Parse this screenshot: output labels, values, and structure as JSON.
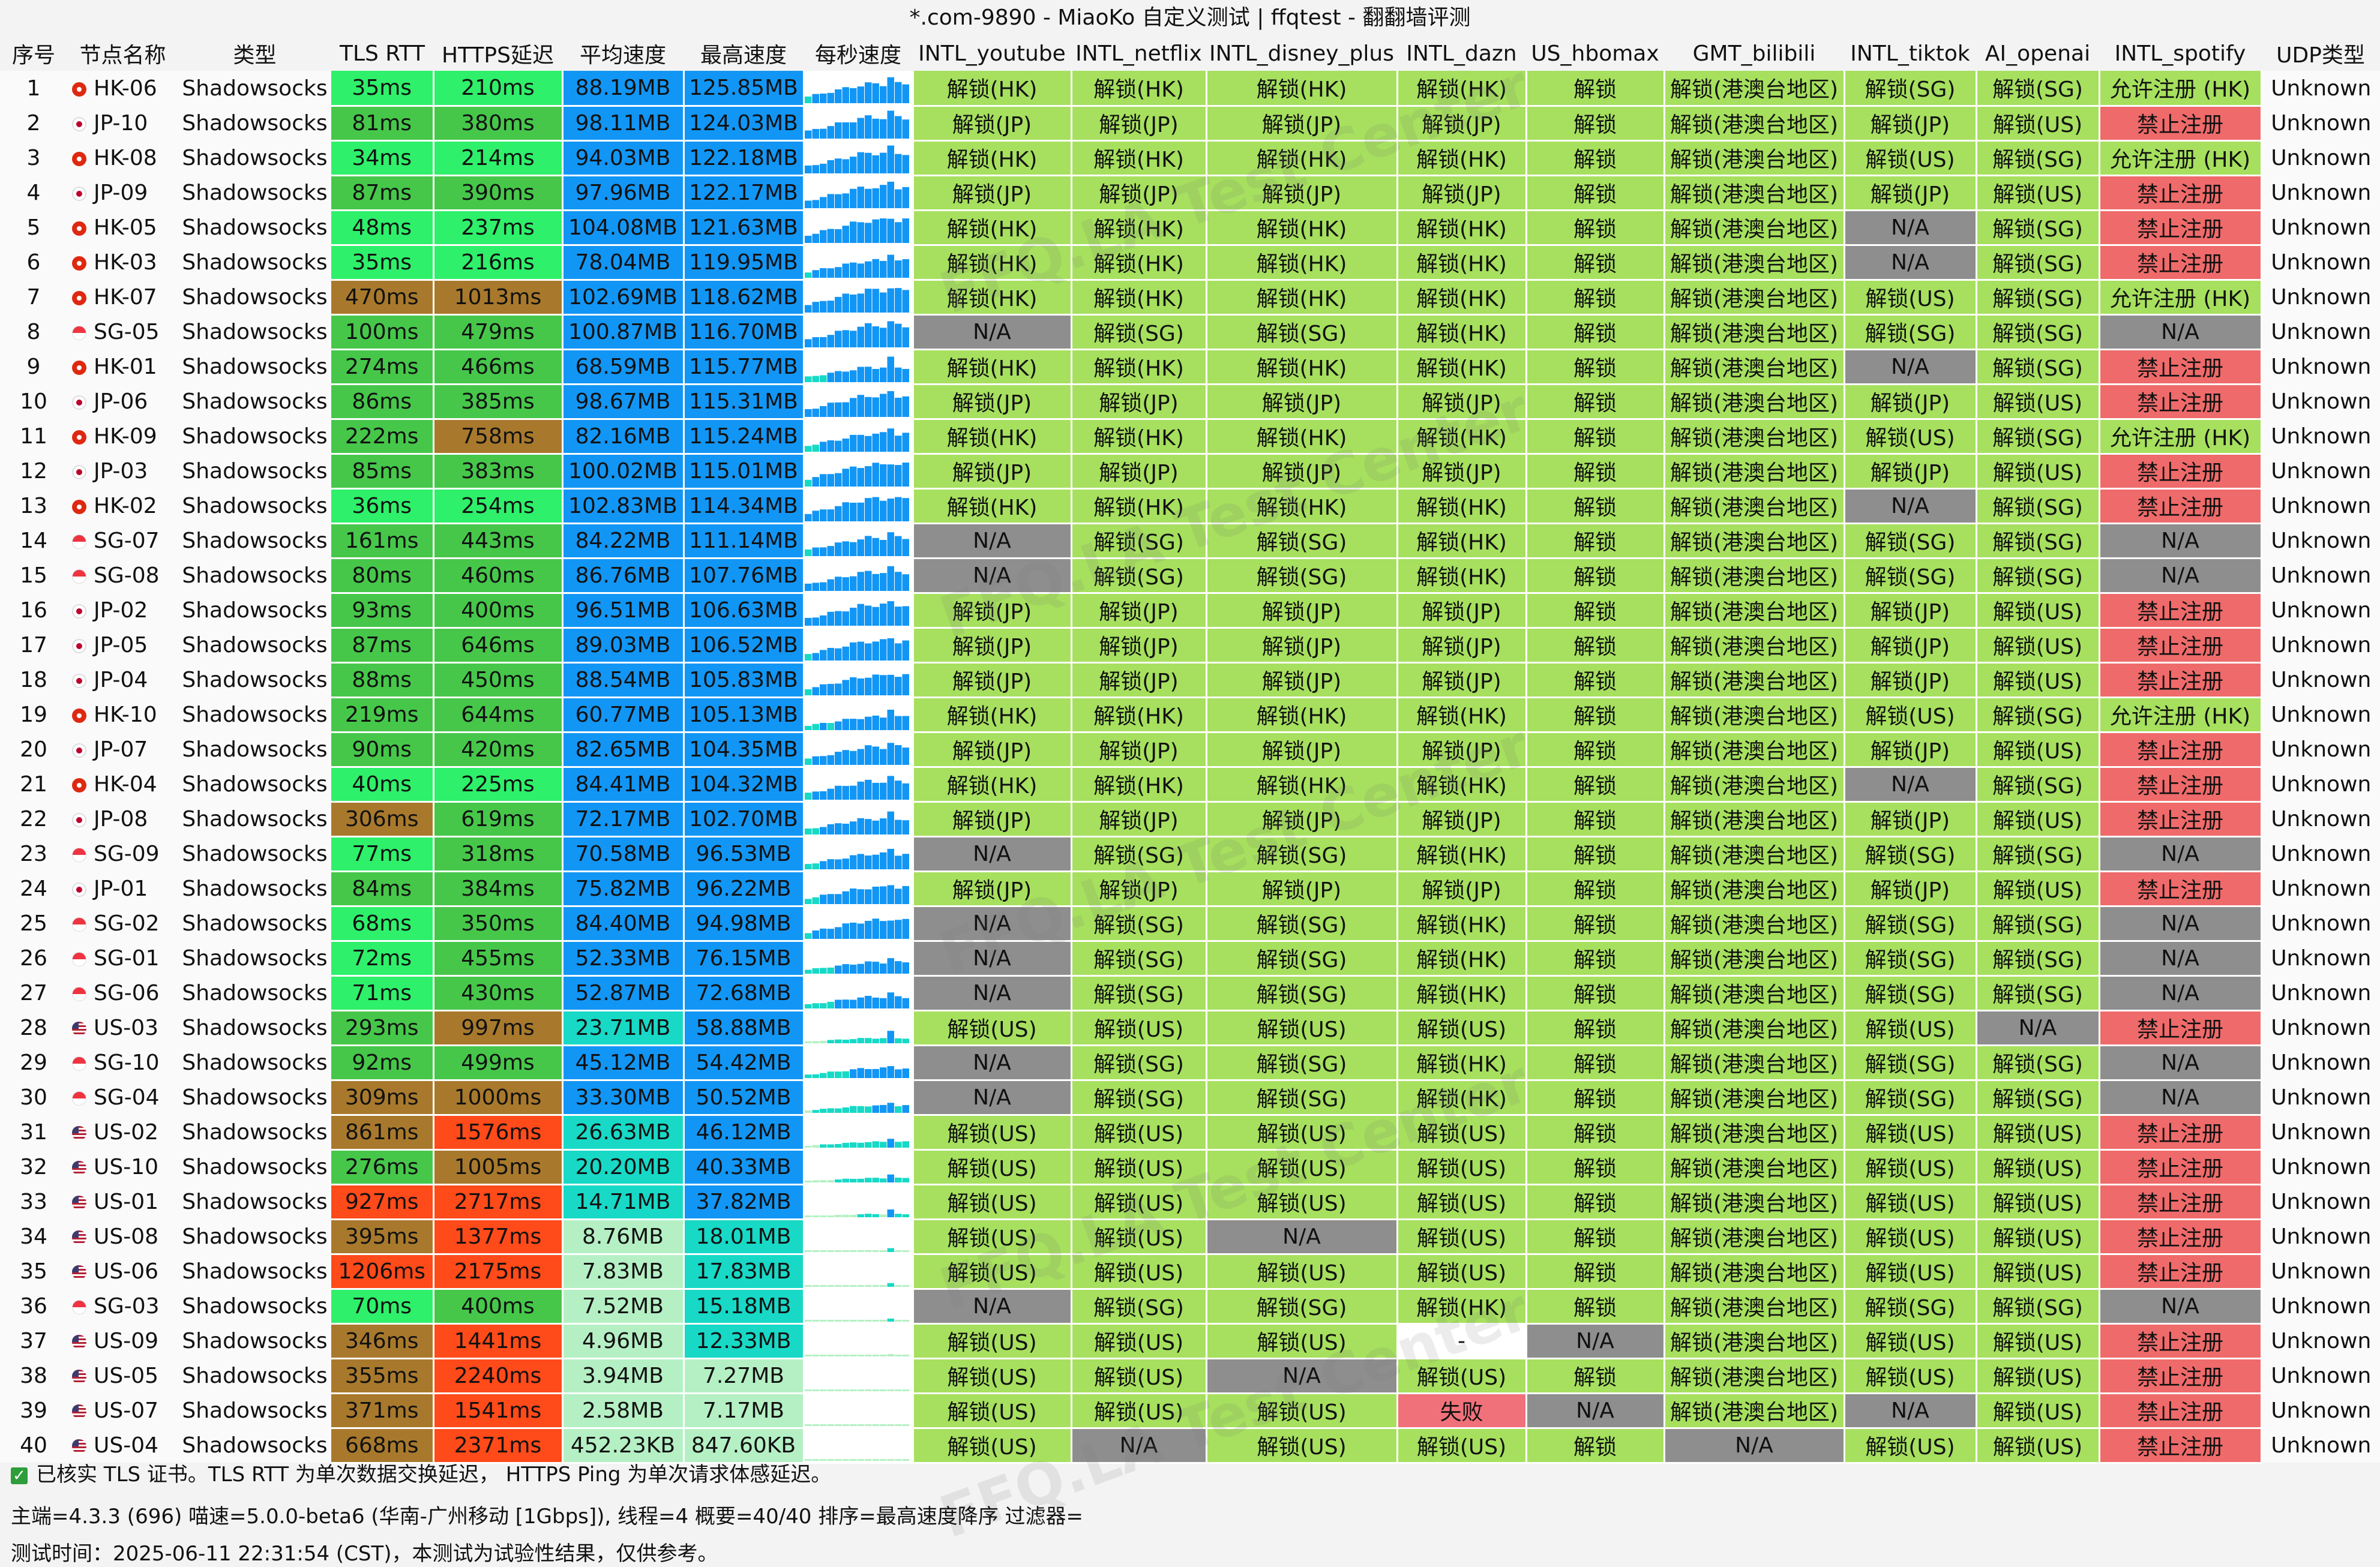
{
  "title": "*.com-9890 - MiaoKo 自定义测试 | ffqtest - 翻翻墙评测",
  "headers": [
    "序号",
    "节点名称",
    "类型",
    "TLS RTT",
    "HTTPS延迟",
    "平均速度",
    "最高速度",
    "每秒速度",
    "INTL_youtube",
    "INTL_netflix",
    "INTL_disney_plus",
    "INTL_dazn",
    "US_hbomax",
    "GMT_bilibili",
    "INTL_tiktok",
    "AI_openai",
    "INTL_spotify",
    "UDP类型"
  ],
  "rows": [
    {
      "no": "1",
      "name": "HK-06",
      "flag": "hk",
      "type": "Shadowsocks",
      "tls": "35ms",
      "https": "210ms",
      "avg": "88.19MB",
      "max": "125.85MB",
      "youtube": "解锁(HK)",
      "netflix": "解锁(HK)",
      "disney": "解锁(HK)",
      "dazn": "解锁(HK)",
      "hbomax": "解锁",
      "bilibili": "解锁(港澳台地区)",
      "tiktok": "解锁(SG)",
      "openai": "解锁(SG)",
      "spotify": "允许注册 (HK)",
      "udp": "Unknown"
    },
    {
      "no": "2",
      "name": "JP-10",
      "flag": "jp",
      "type": "Shadowsocks",
      "tls": "81ms",
      "https": "380ms",
      "avg": "98.11MB",
      "max": "124.03MB",
      "youtube": "解锁(JP)",
      "netflix": "解锁(JP)",
      "disney": "解锁(JP)",
      "dazn": "解锁(JP)",
      "hbomax": "解锁",
      "bilibili": "解锁(港澳台地区)",
      "tiktok": "解锁(JP)",
      "openai": "解锁(US)",
      "spotify": "禁止注册",
      "udp": "Unknown"
    },
    {
      "no": "3",
      "name": "HK-08",
      "flag": "hk",
      "type": "Shadowsocks",
      "tls": "34ms",
      "https": "214ms",
      "avg": "94.03MB",
      "max": "122.18MB",
      "youtube": "解锁(HK)",
      "netflix": "解锁(HK)",
      "disney": "解锁(HK)",
      "dazn": "解锁(HK)",
      "hbomax": "解锁",
      "bilibili": "解锁(港澳台地区)",
      "tiktok": "解锁(US)",
      "openai": "解锁(SG)",
      "spotify": "允许注册 (HK)",
      "udp": "Unknown"
    },
    {
      "no": "4",
      "name": "JP-09",
      "flag": "jp",
      "type": "Shadowsocks",
      "tls": "87ms",
      "https": "390ms",
      "avg": "97.96MB",
      "max": "122.17MB",
      "youtube": "解锁(JP)",
      "netflix": "解锁(JP)",
      "disney": "解锁(JP)",
      "dazn": "解锁(JP)",
      "hbomax": "解锁",
      "bilibili": "解锁(港澳台地区)",
      "tiktok": "解锁(JP)",
      "openai": "解锁(US)",
      "spotify": "禁止注册",
      "udp": "Unknown"
    },
    {
      "no": "5",
      "name": "HK-05",
      "flag": "hk",
      "type": "Shadowsocks",
      "tls": "48ms",
      "https": "237ms",
      "avg": "104.08MB",
      "max": "121.63MB",
      "youtube": "解锁(HK)",
      "netflix": "解锁(HK)",
      "disney": "解锁(HK)",
      "dazn": "解锁(HK)",
      "hbomax": "解锁",
      "bilibili": "解锁(港澳台地区)",
      "tiktok": "N/A",
      "openai": "解锁(SG)",
      "spotify": "禁止注册",
      "udp": "Unknown"
    },
    {
      "no": "6",
      "name": "HK-03",
      "flag": "hk",
      "type": "Shadowsocks",
      "tls": "35ms",
      "https": "216ms",
      "avg": "78.04MB",
      "max": "119.95MB",
      "youtube": "解锁(HK)",
      "netflix": "解锁(HK)",
      "disney": "解锁(HK)",
      "dazn": "解锁(HK)",
      "hbomax": "解锁",
      "bilibili": "解锁(港澳台地区)",
      "tiktok": "N/A",
      "openai": "解锁(SG)",
      "spotify": "禁止注册",
      "udp": "Unknown"
    },
    {
      "no": "7",
      "name": "HK-07",
      "flag": "hk",
      "type": "Shadowsocks",
      "tls": "470ms",
      "https": "1013ms",
      "avg": "102.69MB",
      "max": "118.62MB",
      "youtube": "解锁(HK)",
      "netflix": "解锁(HK)",
      "disney": "解锁(HK)",
      "dazn": "解锁(HK)",
      "hbomax": "解锁",
      "bilibili": "解锁(港澳台地区)",
      "tiktok": "解锁(US)",
      "openai": "解锁(SG)",
      "spotify": "允许注册 (HK)",
      "udp": "Unknown"
    },
    {
      "no": "8",
      "name": "SG-05",
      "flag": "sg",
      "type": "Shadowsocks",
      "tls": "100ms",
      "https": "479ms",
      "avg": "100.87MB",
      "max": "116.70MB",
      "youtube": "N/A",
      "netflix": "解锁(SG)",
      "disney": "解锁(SG)",
      "dazn": "解锁(HK)",
      "hbomax": "解锁",
      "bilibili": "解锁(港澳台地区)",
      "tiktok": "解锁(SG)",
      "openai": "解锁(SG)",
      "spotify": "N/A",
      "udp": "Unknown"
    },
    {
      "no": "9",
      "name": "HK-01",
      "flag": "hk",
      "type": "Shadowsocks",
      "tls": "274ms",
      "https": "466ms",
      "avg": "68.59MB",
      "max": "115.77MB",
      "youtube": "解锁(HK)",
      "netflix": "解锁(HK)",
      "disney": "解锁(HK)",
      "dazn": "解锁(HK)",
      "hbomax": "解锁",
      "bilibili": "解锁(港澳台地区)",
      "tiktok": "N/A",
      "openai": "解锁(SG)",
      "spotify": "禁止注册",
      "udp": "Unknown"
    },
    {
      "no": "10",
      "name": "JP-06",
      "flag": "jp",
      "type": "Shadowsocks",
      "tls": "86ms",
      "https": "385ms",
      "avg": "98.67MB",
      "max": "115.31MB",
      "youtube": "解锁(JP)",
      "netflix": "解锁(JP)",
      "disney": "解锁(JP)",
      "dazn": "解锁(JP)",
      "hbomax": "解锁",
      "bilibili": "解锁(港澳台地区)",
      "tiktok": "解锁(JP)",
      "openai": "解锁(US)",
      "spotify": "禁止注册",
      "udp": "Unknown"
    },
    {
      "no": "11",
      "name": "HK-09",
      "flag": "hk",
      "type": "Shadowsocks",
      "tls": "222ms",
      "https": "758ms",
      "avg": "82.16MB",
      "max": "115.24MB",
      "youtube": "解锁(HK)",
      "netflix": "解锁(HK)",
      "disney": "解锁(HK)",
      "dazn": "解锁(HK)",
      "hbomax": "解锁",
      "bilibili": "解锁(港澳台地区)",
      "tiktok": "解锁(US)",
      "openai": "解锁(SG)",
      "spotify": "允许注册 (HK)",
      "udp": "Unknown"
    },
    {
      "no": "12",
      "name": "JP-03",
      "flag": "jp",
      "type": "Shadowsocks",
      "tls": "85ms",
      "https": "383ms",
      "avg": "100.02MB",
      "max": "115.01MB",
      "youtube": "解锁(JP)",
      "netflix": "解锁(JP)",
      "disney": "解锁(JP)",
      "dazn": "解锁(JP)",
      "hbomax": "解锁",
      "bilibili": "解锁(港澳台地区)",
      "tiktok": "解锁(JP)",
      "openai": "解锁(US)",
      "spotify": "禁止注册",
      "udp": "Unknown"
    },
    {
      "no": "13",
      "name": "HK-02",
      "flag": "hk",
      "type": "Shadowsocks",
      "tls": "36ms",
      "https": "254ms",
      "avg": "102.83MB",
      "max": "114.34MB",
      "youtube": "解锁(HK)",
      "netflix": "解锁(HK)",
      "disney": "解锁(HK)",
      "dazn": "解锁(HK)",
      "hbomax": "解锁",
      "bilibili": "解锁(港澳台地区)",
      "tiktok": "N/A",
      "openai": "解锁(SG)",
      "spotify": "禁止注册",
      "udp": "Unknown"
    },
    {
      "no": "14",
      "name": "SG-07",
      "flag": "sg",
      "type": "Shadowsocks",
      "tls": "161ms",
      "https": "443ms",
      "avg": "84.22MB",
      "max": "111.14MB",
      "youtube": "N/A",
      "netflix": "解锁(SG)",
      "disney": "解锁(SG)",
      "dazn": "解锁(HK)",
      "hbomax": "解锁",
      "bilibili": "解锁(港澳台地区)",
      "tiktok": "解锁(SG)",
      "openai": "解锁(SG)",
      "spotify": "N/A",
      "udp": "Unknown"
    },
    {
      "no": "15",
      "name": "SG-08",
      "flag": "sg",
      "type": "Shadowsocks",
      "tls": "80ms",
      "https": "460ms",
      "avg": "86.76MB",
      "max": "107.76MB",
      "youtube": "N/A",
      "netflix": "解锁(SG)",
      "disney": "解锁(SG)",
      "dazn": "解锁(HK)",
      "hbomax": "解锁",
      "bilibili": "解锁(港澳台地区)",
      "tiktok": "解锁(SG)",
      "openai": "解锁(SG)",
      "spotify": "N/A",
      "udp": "Unknown"
    },
    {
      "no": "16",
      "name": "JP-02",
      "flag": "jp",
      "type": "Shadowsocks",
      "tls": "93ms",
      "https": "400ms",
      "avg": "96.51MB",
      "max": "106.63MB",
      "youtube": "解锁(JP)",
      "netflix": "解锁(JP)",
      "disney": "解锁(JP)",
      "dazn": "解锁(JP)",
      "hbomax": "解锁",
      "bilibili": "解锁(港澳台地区)",
      "tiktok": "解锁(JP)",
      "openai": "解锁(US)",
      "spotify": "禁止注册",
      "udp": "Unknown"
    },
    {
      "no": "17",
      "name": "JP-05",
      "flag": "jp",
      "type": "Shadowsocks",
      "tls": "87ms",
      "https": "646ms",
      "avg": "89.03MB",
      "max": "106.52MB",
      "youtube": "解锁(JP)",
      "netflix": "解锁(JP)",
      "disney": "解锁(JP)",
      "dazn": "解锁(JP)",
      "hbomax": "解锁",
      "bilibili": "解锁(港澳台地区)",
      "tiktok": "解锁(JP)",
      "openai": "解锁(US)",
      "spotify": "禁止注册",
      "udp": "Unknown"
    },
    {
      "no": "18",
      "name": "JP-04",
      "flag": "jp",
      "type": "Shadowsocks",
      "tls": "88ms",
      "https": "450ms",
      "avg": "88.54MB",
      "max": "105.83MB",
      "youtube": "解锁(JP)",
      "netflix": "解锁(JP)",
      "disney": "解锁(JP)",
      "dazn": "解锁(JP)",
      "hbomax": "解锁",
      "bilibili": "解锁(港澳台地区)",
      "tiktok": "解锁(JP)",
      "openai": "解锁(US)",
      "spotify": "禁止注册",
      "udp": "Unknown"
    },
    {
      "no": "19",
      "name": "HK-10",
      "flag": "hk",
      "type": "Shadowsocks",
      "tls": "219ms",
      "https": "644ms",
      "avg": "60.77MB",
      "max": "105.13MB",
      "youtube": "解锁(HK)",
      "netflix": "解锁(HK)",
      "disney": "解锁(HK)",
      "dazn": "解锁(HK)",
      "hbomax": "解锁",
      "bilibili": "解锁(港澳台地区)",
      "tiktok": "解锁(US)",
      "openai": "解锁(SG)",
      "spotify": "允许注册 (HK)",
      "udp": "Unknown"
    },
    {
      "no": "20",
      "name": "JP-07",
      "flag": "jp",
      "type": "Shadowsocks",
      "tls": "90ms",
      "https": "420ms",
      "avg": "82.65MB",
      "max": "104.35MB",
      "youtube": "解锁(JP)",
      "netflix": "解锁(JP)",
      "disney": "解锁(JP)",
      "dazn": "解锁(JP)",
      "hbomax": "解锁",
      "bilibili": "解锁(港澳台地区)",
      "tiktok": "解锁(JP)",
      "openai": "解锁(US)",
      "spotify": "禁止注册",
      "udp": "Unknown"
    },
    {
      "no": "21",
      "name": "HK-04",
      "flag": "hk",
      "type": "Shadowsocks",
      "tls": "40ms",
      "https": "225ms",
      "avg": "84.41MB",
      "max": "104.32MB",
      "youtube": "解锁(HK)",
      "netflix": "解锁(HK)",
      "disney": "解锁(HK)",
      "dazn": "解锁(HK)",
      "hbomax": "解锁",
      "bilibili": "解锁(港澳台地区)",
      "tiktok": "N/A",
      "openai": "解锁(SG)",
      "spotify": "禁止注册",
      "udp": "Unknown"
    },
    {
      "no": "22",
      "name": "JP-08",
      "flag": "jp",
      "type": "Shadowsocks",
      "tls": "306ms",
      "https": "619ms",
      "avg": "72.17MB",
      "max": "102.70MB",
      "youtube": "解锁(JP)",
      "netflix": "解锁(JP)",
      "disney": "解锁(JP)",
      "dazn": "解锁(JP)",
      "hbomax": "解锁",
      "bilibili": "解锁(港澳台地区)",
      "tiktok": "解锁(JP)",
      "openai": "解锁(US)",
      "spotify": "禁止注册",
      "udp": "Unknown"
    },
    {
      "no": "23",
      "name": "SG-09",
      "flag": "sg",
      "type": "Shadowsocks",
      "tls": "77ms",
      "https": "318ms",
      "avg": "70.58MB",
      "max": "96.53MB",
      "youtube": "N/A",
      "netflix": "解锁(SG)",
      "disney": "解锁(SG)",
      "dazn": "解锁(HK)",
      "hbomax": "解锁",
      "bilibili": "解锁(港澳台地区)",
      "tiktok": "解锁(SG)",
      "openai": "解锁(SG)",
      "spotify": "N/A",
      "udp": "Unknown"
    },
    {
      "no": "24",
      "name": "JP-01",
      "flag": "jp",
      "type": "Shadowsocks",
      "tls": "84ms",
      "https": "384ms",
      "avg": "75.82MB",
      "max": "96.22MB",
      "youtube": "解锁(JP)",
      "netflix": "解锁(JP)",
      "disney": "解锁(JP)",
      "dazn": "解锁(JP)",
      "hbomax": "解锁",
      "bilibili": "解锁(港澳台地区)",
      "tiktok": "解锁(JP)",
      "openai": "解锁(US)",
      "spotify": "禁止注册",
      "udp": "Unknown"
    },
    {
      "no": "25",
      "name": "SG-02",
      "flag": "sg",
      "type": "Shadowsocks",
      "tls": "68ms",
      "https": "350ms",
      "avg": "84.40MB",
      "max": "94.98MB",
      "youtube": "N/A",
      "netflix": "解锁(SG)",
      "disney": "解锁(SG)",
      "dazn": "解锁(HK)",
      "hbomax": "解锁",
      "bilibili": "解锁(港澳台地区)",
      "tiktok": "解锁(SG)",
      "openai": "解锁(SG)",
      "spotify": "N/A",
      "udp": "Unknown"
    },
    {
      "no": "26",
      "name": "SG-01",
      "flag": "sg",
      "type": "Shadowsocks",
      "tls": "72ms",
      "https": "455ms",
      "avg": "52.33MB",
      "max": "76.15MB",
      "youtube": "N/A",
      "netflix": "解锁(SG)",
      "disney": "解锁(SG)",
      "dazn": "解锁(HK)",
      "hbomax": "解锁",
      "bilibili": "解锁(港澳台地区)",
      "tiktok": "解锁(SG)",
      "openai": "解锁(SG)",
      "spotify": "N/A",
      "udp": "Unknown"
    },
    {
      "no": "27",
      "name": "SG-06",
      "flag": "sg",
      "type": "Shadowsocks",
      "tls": "71ms",
      "https": "430ms",
      "avg": "52.87MB",
      "max": "72.68MB",
      "youtube": "N/A",
      "netflix": "解锁(SG)",
      "disney": "解锁(SG)",
      "dazn": "解锁(HK)",
      "hbomax": "解锁",
      "bilibili": "解锁(港澳台地区)",
      "tiktok": "解锁(SG)",
      "openai": "解锁(SG)",
      "spotify": "N/A",
      "udp": "Unknown"
    },
    {
      "no": "28",
      "name": "US-03",
      "flag": "us",
      "type": "Shadowsocks",
      "tls": "293ms",
      "https": "997ms",
      "avg": "23.71MB",
      "max": "58.88MB",
      "youtube": "解锁(US)",
      "netflix": "解锁(US)",
      "disney": "解锁(US)",
      "dazn": "解锁(US)",
      "hbomax": "解锁",
      "bilibili": "解锁(港澳台地区)",
      "tiktok": "解锁(US)",
      "openai": "N/A",
      "spotify": "禁止注册",
      "udp": "Unknown"
    },
    {
      "no": "29",
      "name": "SG-10",
      "flag": "sg",
      "type": "Shadowsocks",
      "tls": "92ms",
      "https": "499ms",
      "avg": "45.12MB",
      "max": "54.42MB",
      "youtube": "N/A",
      "netflix": "解锁(SG)",
      "disney": "解锁(SG)",
      "dazn": "解锁(HK)",
      "hbomax": "解锁",
      "bilibili": "解锁(港澳台地区)",
      "tiktok": "解锁(SG)",
      "openai": "解锁(SG)",
      "spotify": "N/A",
      "udp": "Unknown"
    },
    {
      "no": "30",
      "name": "SG-04",
      "flag": "sg",
      "type": "Shadowsocks",
      "tls": "309ms",
      "https": "1000ms",
      "avg": "33.30MB",
      "max": "50.52MB",
      "youtube": "N/A",
      "netflix": "解锁(SG)",
      "disney": "解锁(SG)",
      "dazn": "解锁(HK)",
      "hbomax": "解锁",
      "bilibili": "解锁(港澳台地区)",
      "tiktok": "解锁(SG)",
      "openai": "解锁(SG)",
      "spotify": "N/A",
      "udp": "Unknown"
    },
    {
      "no": "31",
      "name": "US-02",
      "flag": "us",
      "type": "Shadowsocks",
      "tls": "861ms",
      "https": "1576ms",
      "avg": "26.63MB",
      "max": "46.12MB",
      "youtube": "解锁(US)",
      "netflix": "解锁(US)",
      "disney": "解锁(US)",
      "dazn": "解锁(US)",
      "hbomax": "解锁",
      "bilibili": "解锁(港澳台地区)",
      "tiktok": "解锁(US)",
      "openai": "解锁(US)",
      "spotify": "禁止注册",
      "udp": "Unknown"
    },
    {
      "no": "32",
      "name": "US-10",
      "flag": "us",
      "type": "Shadowsocks",
      "tls": "276ms",
      "https": "1005ms",
      "avg": "20.20MB",
      "max": "40.33MB",
      "youtube": "解锁(US)",
      "netflix": "解锁(US)",
      "disney": "解锁(US)",
      "dazn": "解锁(US)",
      "hbomax": "解锁",
      "bilibili": "解锁(港澳台地区)",
      "tiktok": "解锁(US)",
      "openai": "解锁(US)",
      "spotify": "禁止注册",
      "udp": "Unknown"
    },
    {
      "no": "33",
      "name": "US-01",
      "flag": "us",
      "type": "Shadowsocks",
      "tls": "927ms",
      "https": "2717ms",
      "avg": "14.71MB",
      "max": "37.82MB",
      "youtube": "解锁(US)",
      "netflix": "解锁(US)",
      "disney": "解锁(US)",
      "dazn": "解锁(US)",
      "hbomax": "解锁",
      "bilibili": "解锁(港澳台地区)",
      "tiktok": "解锁(US)",
      "openai": "解锁(US)",
      "spotify": "禁止注册",
      "udp": "Unknown"
    },
    {
      "no": "34",
      "name": "US-08",
      "flag": "us",
      "type": "Shadowsocks",
      "tls": "395ms",
      "https": "1377ms",
      "avg": "8.76MB",
      "max": "18.01MB",
      "youtube": "解锁(US)",
      "netflix": "解锁(US)",
      "disney": "N/A",
      "dazn": "解锁(US)",
      "hbomax": "解锁",
      "bilibili": "解锁(港澳台地区)",
      "tiktok": "解锁(US)",
      "openai": "解锁(US)",
      "spotify": "禁止注册",
      "udp": "Unknown"
    },
    {
      "no": "35",
      "name": "US-06",
      "flag": "us",
      "type": "Shadowsocks",
      "tls": "1206ms",
      "https": "2175ms",
      "avg": "7.83MB",
      "max": "17.83MB",
      "youtube": "解锁(US)",
      "netflix": "解锁(US)",
      "disney": "解锁(US)",
      "dazn": "解锁(US)",
      "hbomax": "解锁",
      "bilibili": "解锁(港澳台地区)",
      "tiktok": "解锁(US)",
      "openai": "解锁(US)",
      "spotify": "禁止注册",
      "udp": "Unknown"
    },
    {
      "no": "36",
      "name": "SG-03",
      "flag": "sg",
      "type": "Shadowsocks",
      "tls": "70ms",
      "https": "400ms",
      "avg": "7.52MB",
      "max": "15.18MB",
      "youtube": "N/A",
      "netflix": "解锁(SG)",
      "disney": "解锁(SG)",
      "dazn": "解锁(HK)",
      "hbomax": "解锁",
      "bilibili": "解锁(港澳台地区)",
      "tiktok": "解锁(SG)",
      "openai": "解锁(SG)",
      "spotify": "N/A",
      "udp": "Unknown"
    },
    {
      "no": "37",
      "name": "US-09",
      "flag": "us",
      "type": "Shadowsocks",
      "tls": "346ms",
      "https": "1441ms",
      "avg": "4.96MB",
      "max": "12.33MB",
      "youtube": "解锁(US)",
      "netflix": "解锁(US)",
      "disney": "解锁(US)",
      "dazn": "-",
      "hbomax": "N/A",
      "bilibili": "解锁(港澳台地区)",
      "tiktok": "解锁(US)",
      "openai": "解锁(US)",
      "spotify": "禁止注册",
      "udp": "Unknown"
    },
    {
      "no": "38",
      "name": "US-05",
      "flag": "us",
      "type": "Shadowsocks",
      "tls": "355ms",
      "https": "2240ms",
      "avg": "3.94MB",
      "max": "7.27MB",
      "youtube": "解锁(US)",
      "netflix": "解锁(US)",
      "disney": "N/A",
      "dazn": "解锁(US)",
      "hbomax": "解锁",
      "bilibili": "解锁(港澳台地区)",
      "tiktok": "解锁(US)",
      "openai": "解锁(US)",
      "spotify": "禁止注册",
      "udp": "Unknown"
    },
    {
      "no": "39",
      "name": "US-07",
      "flag": "us",
      "type": "Shadowsocks",
      "tls": "371ms",
      "https": "1541ms",
      "avg": "2.58MB",
      "max": "7.17MB",
      "youtube": "解锁(US)",
      "netflix": "解锁(US)",
      "disney": "解锁(US)",
      "dazn": "失败",
      "hbomax": "N/A",
      "bilibili": "解锁(港澳台地区)",
      "tiktok": "N/A",
      "openai": "解锁(US)",
      "spotify": "禁止注册",
      "udp": "Unknown"
    },
    {
      "no": "40",
      "name": "US-04",
      "flag": "us",
      "type": "Shadowsocks",
      "tls": "668ms",
      "https": "2371ms",
      "avg": "452.23KB",
      "max": "847.60KB",
      "youtube": "解锁(US)",
      "netflix": "N/A",
      "disney": "解锁(US)",
      "dazn": "解锁(US)",
      "hbomax": "解锁",
      "bilibili": "N/A",
      "tiktok": "解锁(US)",
      "openai": "解锁(US)",
      "spotify": "禁止注册",
      "udp": "Unknown"
    }
  ],
  "footer": {
    "note": "已核实 TLS 证书。TLS RTT 为单次数据交换延迟， HTTPS Ping 为单次请求体感延迟。",
    "info": "主端=4.3.3 (696) 喵速=5.0.0-beta6 (华南-广州移动 [1Gbps]), 线程=4 概要=40/40 排序=最高速度降序 过滤器=",
    "time": "测试时间：2025-06-11 22:31:54 (CST)，本测试为试验性结果，仅供参考。"
  },
  "watermark": "FFQ.LA Test Center",
  "colors": {
    "unlock": "#a6e05e",
    "na": "#8e8e8e",
    "banned": "#ef6a6a",
    "failed": "#f0717a",
    "blank": "#ffffff",
    "speed_fast": "#1296f5",
    "speed_mid": "#17d9c6",
    "speed_slow": "#b5f0c4",
    "lat_good": "#2ef06a",
    "lat_ok": "#46c74a",
    "lat_warn": "#a8792c",
    "lat_bad": "#ff4a1a"
  }
}
